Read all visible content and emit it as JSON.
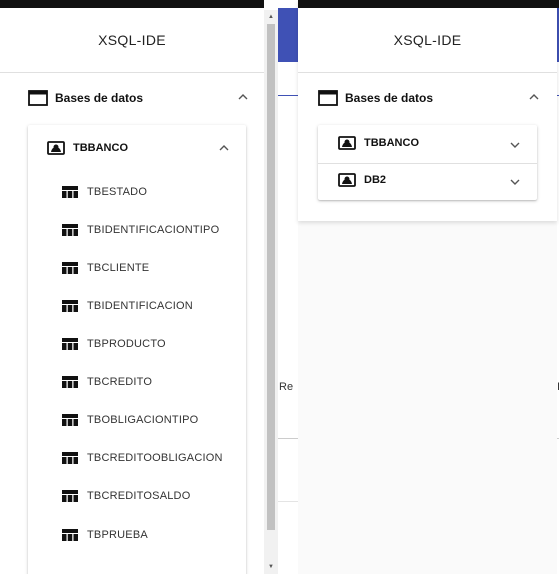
{
  "colors": {
    "accent": "#3f51b5",
    "text_primary": "#212121",
    "divider": "#e0e0e0",
    "scrollbar_thumb": "#c1c1c1"
  },
  "left_panel": {
    "app_title": "XSQL-IDE",
    "section": {
      "label": "Bases de datos",
      "icon": "folder-icon",
      "state_icon": "chevron-up-icon"
    },
    "database": {
      "name": "TBBANCO",
      "icon": "database-icon",
      "state_icon": "chevron-up-icon",
      "tables": [
        "TBESTADO",
        "TBIDENTIFICACIONTIPO",
        "TBCLIENTE",
        "TBIDENTIFICACION",
        "TBPRODUCTO",
        "TBCREDITO",
        "TBOBLIGACIONTIPO",
        "TBCREDITOOBLIGACION",
        "TBCREDITOSALDO",
        "TBPRUEBA"
      ],
      "table_icon": "table-icon"
    }
  },
  "middle_peek": {
    "text": "Re"
  },
  "right_panel": {
    "app_title": "XSQL-IDE",
    "section": {
      "label": "Bases de datos",
      "icon": "folder-icon",
      "state_icon": "chevron-up-icon"
    },
    "databases": [
      {
        "name": "TBBANCO",
        "icon": "database-icon",
        "state_icon": "chevron-down-icon"
      },
      {
        "name": "DB2",
        "icon": "database-icon",
        "state_icon": "chevron-down-icon"
      }
    ],
    "edge_text": "I"
  }
}
